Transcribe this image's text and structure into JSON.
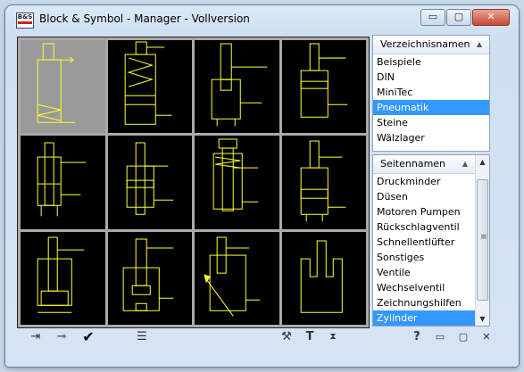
{
  "window": {
    "title": "Block & Symbol - Manager - Vollversion",
    "app_icon_text": "B&S",
    "minimize_glyph": "▭",
    "maximize_glyph": "▢",
    "close_glyph": "✕"
  },
  "directories": {
    "header": "Verzeichnisnamen",
    "sort_glyph": "▲",
    "items": [
      "Beispiele",
      "DIN",
      "MiniTec",
      "Pneumatik",
      "Steine",
      "Wälzlager"
    ],
    "selected": "Pneumatik"
  },
  "pages": {
    "header": "Seitennamen",
    "sort_glyph": "▲",
    "items": [
      "Druckminder",
      "Düsen",
      "Motoren Pumpen",
      "Rückschlagventil",
      "Schnellentlüfter",
      "Sonstiges",
      "Ventile",
      "Wechselventil",
      "Zeichnungshilfen",
      "Zylinder"
    ],
    "selected": "Zylinder",
    "scroll_up_glyph": "▲",
    "scroll_down_glyph": "▼",
    "scroll_grip_glyph": "≡"
  },
  "symbols": {
    "line_color": "#ffff33",
    "selected_bg": "#9a9a9a",
    "selected_index": 0
  },
  "toolbar": {
    "exit_icon": "⇥",
    "pin_icon": "⊸",
    "ok_icon": "✔",
    "list_icon": "☰",
    "tools_icon": "⚒",
    "text_icon": "T",
    "sort_icon": "⧗",
    "help_icon": "?",
    "minimize_icon": "▭",
    "restore_icon": "▢",
    "close_icon": "✕"
  }
}
